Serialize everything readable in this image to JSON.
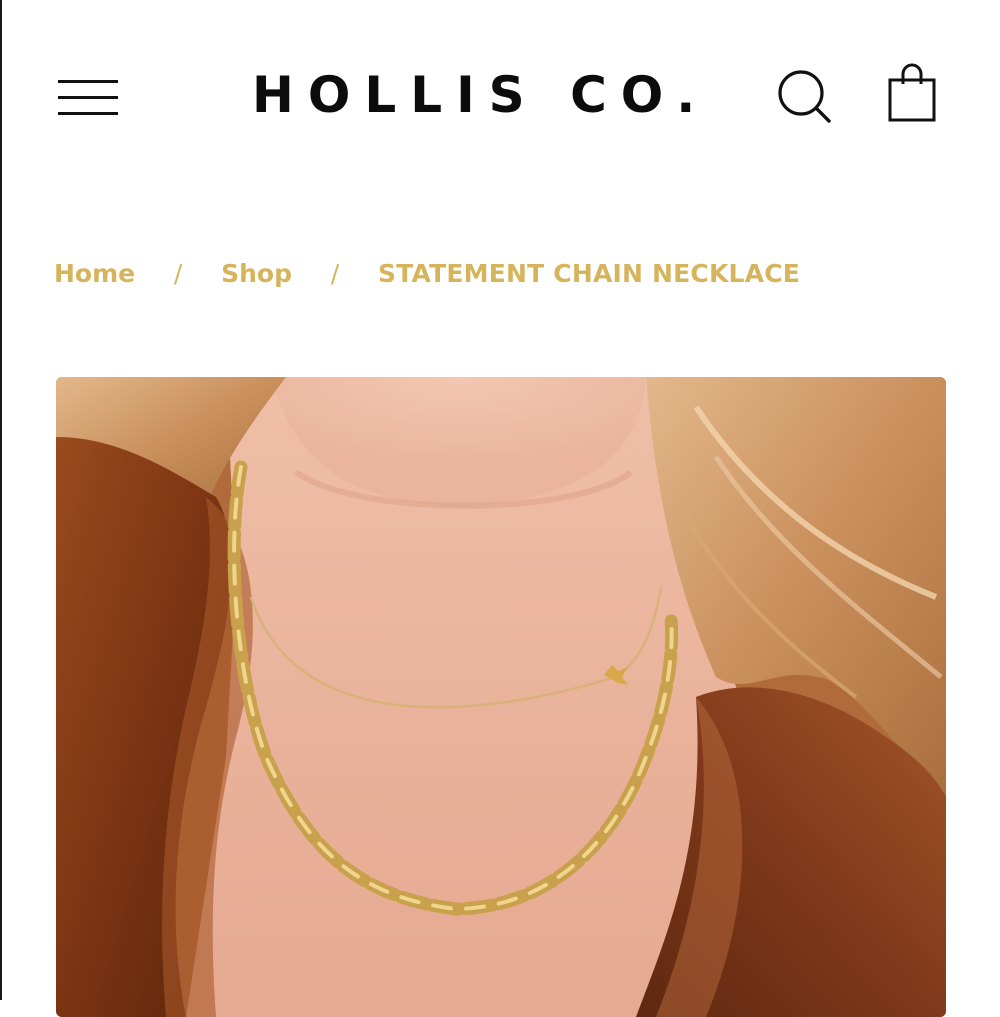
{
  "header": {
    "brand": "HOLLIS CO.",
    "icons": {
      "menu": "menu-icon",
      "search": "search-icon",
      "cart": "shopping-bag-icon"
    }
  },
  "breadcrumb": {
    "items": [
      "Home",
      "Shop",
      "STATEMENT CHAIN NECKLACE"
    ],
    "separator": "/"
  },
  "colors": {
    "breadcrumb": "#d6b45c",
    "text": "#0c0c0c",
    "background": "#ffffff"
  }
}
